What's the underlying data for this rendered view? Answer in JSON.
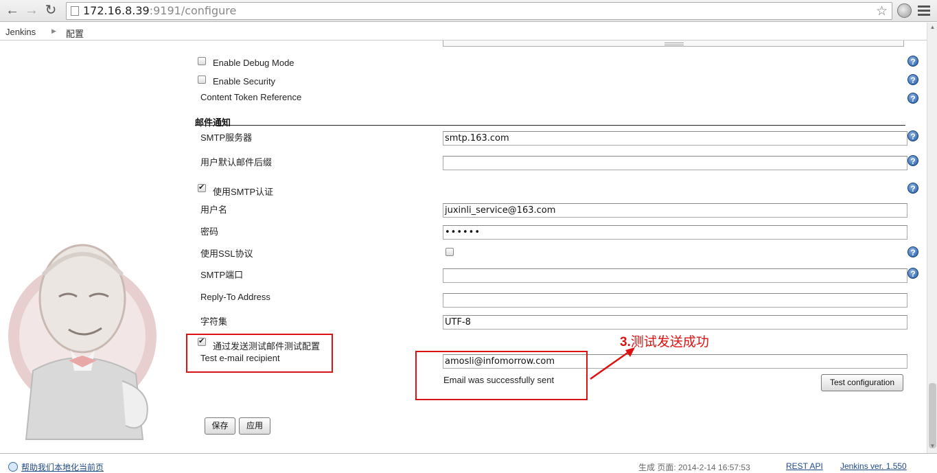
{
  "browser": {
    "back_icon": "arrow-left-icon",
    "forward_icon": "arrow-right-icon",
    "reload_icon": "reload-icon",
    "url_host": "172.16.8.39",
    "url_rest": ":9191/configure"
  },
  "breadcrumb": {
    "root": "Jenkins",
    "current": "配置"
  },
  "top_options": {
    "debug_label": "Enable Debug Mode",
    "security_label": "Enable Security",
    "token_label": "Content Token Reference"
  },
  "email": {
    "section_title": "邮件通知",
    "smtp_server_label": "SMTP服务器",
    "smtp_server_value": "smtp.163.com",
    "suffix_label": "用户默认邮件后缀",
    "suffix_value": "",
    "smtp_auth_label": "使用SMTP认证",
    "username_label": "用户名",
    "username_value": "juxinli_service@163.com",
    "password_label": "密码",
    "password_value": "••••••",
    "ssl_label": "使用SSL协议",
    "port_label": "SMTP端口",
    "port_value": "",
    "reply_label": "Reply-To Address",
    "reply_value": "",
    "charset_label": "字符集",
    "charset_value": "UTF-8",
    "test_toggle_label": "通过发送测试邮件测试配置",
    "recipient_label": "Test e-mail recipient",
    "recipient_value": "amosli@infomorrow.com",
    "status_text": "Email was successfully sent",
    "test_button": "Test configuration"
  },
  "buttons": {
    "save": "保存",
    "apply": "应用"
  },
  "annotation": {
    "num": "3.",
    "text": "测试发送成功"
  },
  "footer": {
    "localize_link": "帮助我们本地化当前页",
    "generated": "生成 页面: 2014-2-14 16:57:53",
    "rest_api": "REST API",
    "version": "Jenkins ver. 1.550"
  },
  "colors": {
    "annotation_red": "#dd1111",
    "help_blue": "#1e5aa8",
    "link_blue": "#204a87"
  }
}
